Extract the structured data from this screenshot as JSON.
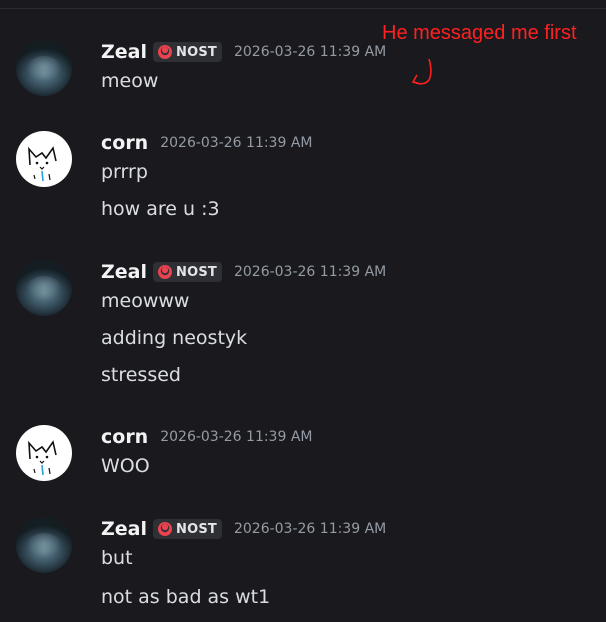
{
  "annotation": {
    "text": "He messaged me first",
    "color": "#ff2020"
  },
  "colors": {
    "background": "#1a1a1e",
    "username": "#f2f3f5",
    "timestamp": "#949ba4",
    "message": "#dbdee1",
    "badge_bg": "#2e3035"
  },
  "messages": [
    {
      "author": "Zeal",
      "avatar": "zeal-avatar",
      "tag": "NOST",
      "timestamp": "2026-03-26 11:39 AM",
      "lines": [
        "meow"
      ]
    },
    {
      "author": "corn",
      "avatar": "corn-avatar",
      "timestamp": "2026-03-26 11:39 AM",
      "lines": [
        "prrrp",
        "how are u :3"
      ]
    },
    {
      "author": "Zeal",
      "avatar": "zeal-avatar",
      "tag": "NOST",
      "timestamp": "2026-03-26 11:39 AM",
      "lines": [
        "meowww",
        "adding neostyk",
        "stressed"
      ]
    },
    {
      "author": "corn",
      "avatar": "corn-avatar",
      "timestamp": "2026-03-26 11:39 AM",
      "lines": [
        "WOO"
      ]
    },
    {
      "author": "Zeal",
      "avatar": "zeal-avatar",
      "tag": "NOST",
      "timestamp": "2026-03-26 11:39 AM",
      "lines": [
        "but",
        "not as bad as wt1"
      ]
    }
  ]
}
